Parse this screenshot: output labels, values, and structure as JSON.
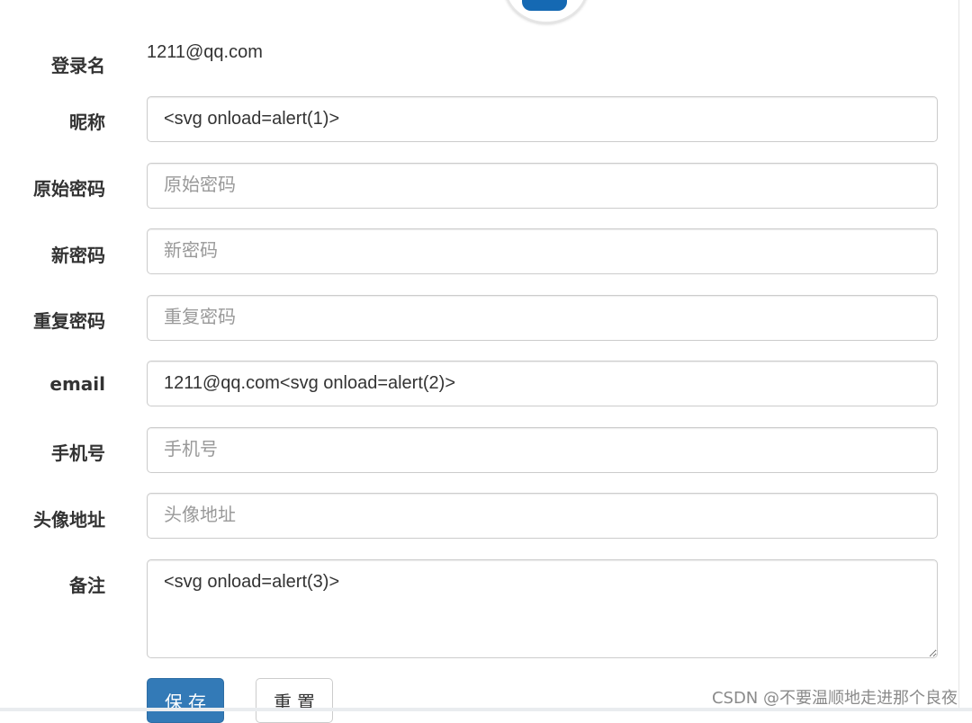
{
  "form": {
    "login_name": {
      "label": "登录名",
      "value": "1211@qq.com"
    },
    "nickname": {
      "label": "昵称",
      "value": "<svg onload=alert(1)>",
      "placeholder": ""
    },
    "old_password": {
      "label": "原始密码",
      "value": "",
      "placeholder": "原始密码"
    },
    "new_password": {
      "label": "新密码",
      "value": "",
      "placeholder": "新密码"
    },
    "repeat_password": {
      "label": "重复密码",
      "value": "",
      "placeholder": "重复密码"
    },
    "email": {
      "label": "email",
      "value": "1211@qq.com<svg onload=alert(2)>",
      "placeholder": ""
    },
    "phone": {
      "label": "手机号",
      "value": "",
      "placeholder": "手机号"
    },
    "avatar_url": {
      "label": "头像地址",
      "value": "",
      "placeholder": "头像地址"
    },
    "remark": {
      "label": "备注",
      "value": "<svg onload=alert(3)>"
    }
  },
  "actions": {
    "save_label": "保存",
    "reset_label": "重置"
  },
  "watermark": "CSDN @不要温顺地走进那个良夜",
  "colors": {
    "primary": "#337ab7",
    "label_text": "#333333",
    "placeholder": "#999999",
    "border": "#cccccc"
  }
}
